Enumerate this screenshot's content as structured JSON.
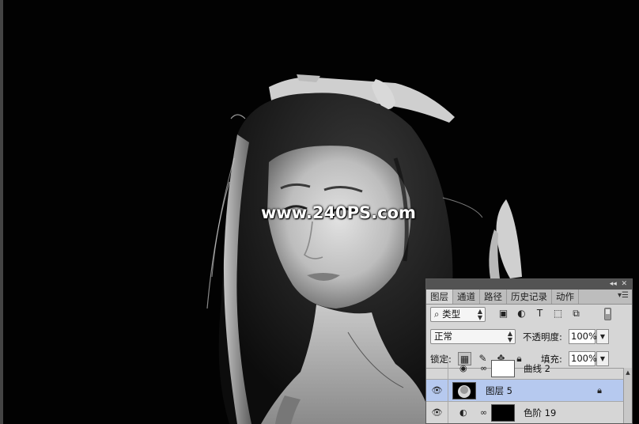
{
  "watermark": "www.240PS.com",
  "panel": {
    "tabs": [
      {
        "label": "图层",
        "active": true
      },
      {
        "label": "通道",
        "active": false
      },
      {
        "label": "路径",
        "active": false
      },
      {
        "label": "历史记录",
        "active": false
      },
      {
        "label": "动作",
        "active": false
      }
    ],
    "filter": {
      "search_icon": "⌕",
      "label": "类型"
    },
    "blend_mode": "正常",
    "opacity_label": "不透明度:",
    "opacity_value": "100%",
    "lock_label": "锁定:",
    "fill_label": "填充:",
    "fill_value": "100%",
    "layers": [
      {
        "name": "曲线 2",
        "visible": false
      },
      {
        "name": "图层 5",
        "visible": true,
        "selected": true
      },
      {
        "name": "色阶 19",
        "visible": true
      }
    ]
  },
  "colors": {
    "selected_layer": "#b6c9ef",
    "panel_bg": "#d6d6d6",
    "canvas_bg": "#020202"
  }
}
